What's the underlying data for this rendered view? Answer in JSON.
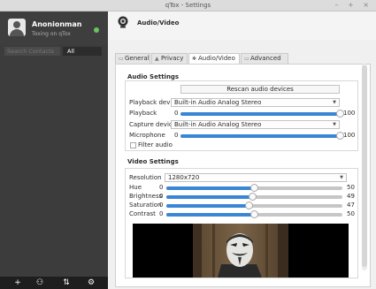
{
  "window": {
    "title": "qTox - Settings",
    "controls": "– + ×"
  },
  "profile": {
    "name": "Anonionman",
    "status": "Toxing on qTox",
    "status_color": "#6bc260"
  },
  "search": {
    "placeholder": "Search Contacts",
    "filter": "All"
  },
  "bottom_bar": {
    "add": "+",
    "group": "⚇",
    "transfer": "⇅",
    "settings": "⚙"
  },
  "header": {
    "title": "Audio/Video",
    "icon": "webcam-icon"
  },
  "tabs": [
    {
      "label": "General",
      "icon": "general-icon"
    },
    {
      "label": "Privacy",
      "icon": "lock-icon"
    },
    {
      "label": "Audio/Video",
      "icon": "av-icon"
    },
    {
      "label": "Advanced",
      "icon": "advanced-icon"
    }
  ],
  "audio": {
    "title": "Audio Settings",
    "rescan": "Rescan audio devices",
    "playback_device_label": "Playback device",
    "playback_device": "Built-in Audio Analog Stereo",
    "playback_label": "Playback",
    "playback_min": "0",
    "playback_max": "100",
    "playback_level": 1.0,
    "capture_device_label": "Capture device",
    "capture_device": "Built-in Audio Analog Stereo",
    "microphone_label": "Microphone",
    "microphone_min": "0",
    "microphone_max": "100",
    "microphone_level": 1.0,
    "filter_audio": "Filter audio"
  },
  "video": {
    "title": "Video Settings",
    "resolution_label": "Resolution",
    "resolution": "1280x720",
    "sliders": [
      {
        "label": "Hue",
        "min": "0",
        "value": "50",
        "level": 0.5
      },
      {
        "label": "Brightness",
        "min": "0",
        "value": "49",
        "level": 0.49
      },
      {
        "label": "Saturation",
        "min": "0",
        "value": "47",
        "level": 0.47
      },
      {
        "label": "Contrast",
        "min": "0",
        "value": "50",
        "level": 0.5
      }
    ]
  },
  "colors": {
    "accent": "#3a86d4",
    "sidebar": "#3c3c3c"
  }
}
